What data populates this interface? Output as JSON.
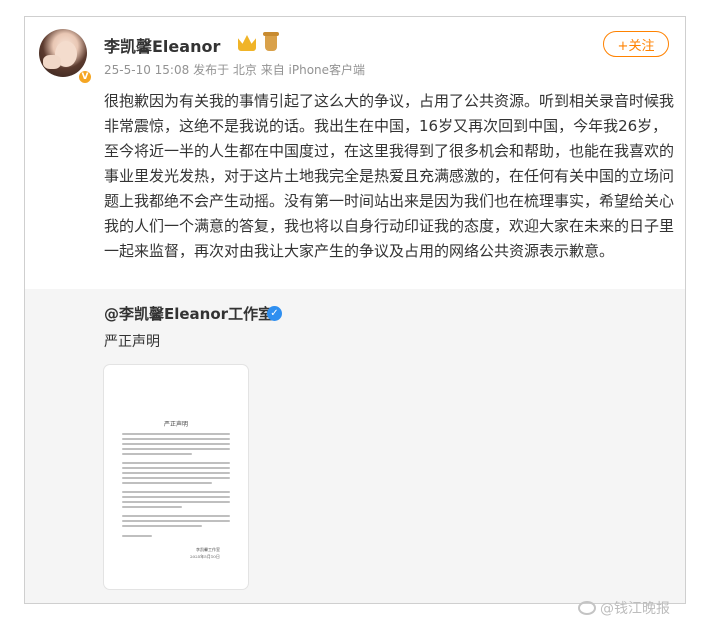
{
  "post": {
    "author": "李凯馨Eleanor",
    "timestamp": "25-5-10 15:08",
    "location": "发布于 北京",
    "source": "来自 iPhone客户端",
    "follow_label": "+关注",
    "text": "很抱歉因为有关我的事情引起了这么大的争议，占用了公共资源。听到相关录音时候我非常震惊，这绝不是我说的话。我出生在中国，16岁又再次回到中国，今年我26岁，至今将近一半的人生都在中国度过，在这里我得到了很多机会和帮助，也能在我喜欢的事业里发光发热，对于这片土地我完全是热爱且充满感激的，在任何有关中国的立场问题上我都绝不会产生动摇。没有第一时间站出来是因为我们也在梳理事实，希望给关心我的人们一个满意的答复，我也将以自身行动印证我的态度，欢迎大家在未来的日子里一起来监督，再次对由我让大家产生的争议及占用的网络公共资源表示歉意。"
  },
  "repost": {
    "author": "@李凯馨Eleanor工作室",
    "text": "严正声明",
    "document": {
      "title": "严正声明",
      "signature": "李凯馨工作室",
      "date": "2025年5月10日"
    }
  },
  "watermark": "@钱江晚报",
  "icons": {
    "verified": "orange-v-icon",
    "crown": "crown-badge-icon",
    "cup": "cup-badge-icon",
    "blue_verified": "blue-v-icon",
    "weibo": "weibo-logo-icon"
  },
  "colors": {
    "accent": "#ff8200",
    "meta_text": "#939393",
    "repost_bg": "#f5f5f5",
    "verified_blue": "#2f8ff0"
  }
}
